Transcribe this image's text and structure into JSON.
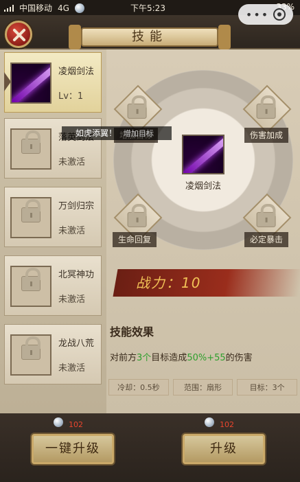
{
  "status_bar": {
    "carrier": "中国移动",
    "network": "4G",
    "time": "下午5:23",
    "battery": "33%"
  },
  "window": {
    "title": "技能"
  },
  "skills_list": [
    {
      "name": "凌烟剑法",
      "state": "Lv：1",
      "active": true
    },
    {
      "name": "落英剑法",
      "state": "未激活",
      "active": false
    },
    {
      "name": "万剑归宗",
      "state": "未激活",
      "active": false
    },
    {
      "name": "北冥神功",
      "state": "未激活",
      "active": false
    },
    {
      "name": "龙战八荒",
      "state": "未激活",
      "active": false
    }
  ],
  "tooltip": {
    "text": "如虎添翼！",
    "sub": "增加目标"
  },
  "skill_tree": {
    "center": "凌烟剑法",
    "nodes": {
      "top_left": "增加目标",
      "top_right": "伤害加成",
      "bottom_left": "生命回复",
      "bottom_right": "必定暴击"
    }
  },
  "power": {
    "label": "战力：10"
  },
  "effect": {
    "title": "技能效果",
    "text_prefix": "对前方",
    "count": "3个",
    "text_mid": "目标造成",
    "damage": "50%+55",
    "text_suffix": "的伤害"
  },
  "stats": {
    "cooldown": "冷却：0.5秒",
    "range": "范围：扇形",
    "target": "目标：3个"
  },
  "bottom": {
    "left_cost": "102",
    "left_button": "一键升级",
    "right_cost": "102",
    "right_button": "升级"
  },
  "icons": [
    "close-icon",
    "lock-icon",
    "sword-skill-icon",
    "coin-icon"
  ]
}
